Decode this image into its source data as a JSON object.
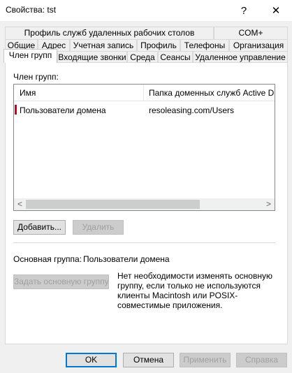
{
  "window": {
    "title": "Свойства: tst",
    "help_label": "?",
    "close_label": "✕"
  },
  "tabs": {
    "row1": [
      {
        "label": "Профиль служб удаленных рабочих столов"
      },
      {
        "label": "COM+"
      }
    ],
    "row2": [
      {
        "label": "Общие"
      },
      {
        "label": "Адрес"
      },
      {
        "label": "Учетная запись"
      },
      {
        "label": "Профиль"
      },
      {
        "label": "Телефоны"
      },
      {
        "label": "Организация"
      }
    ],
    "row3": [
      {
        "label": "Член групп"
      },
      {
        "label": "Входящие звонки"
      },
      {
        "label": "Среда"
      },
      {
        "label": "Сеансы"
      },
      {
        "label": "Удаленное управление"
      }
    ],
    "active": "Член групп"
  },
  "member_of": {
    "section_label": "Член групп:",
    "columns": [
      "Имя",
      "Папка доменных служб Active Directory"
    ],
    "rows": [
      {
        "name": "Пользователи домена",
        "folder": "resoleasing.com/Users"
      }
    ],
    "scroll_left": "<",
    "scroll_right": ">"
  },
  "buttons": {
    "add": "Добавить...",
    "remove": "Удалить",
    "set_primary": "Задать основную группу",
    "ok": "OK",
    "cancel": "Отмена",
    "apply": "Применить",
    "help": "Справка"
  },
  "primary_group": {
    "label": "Основная группа:",
    "value": "Пользователи домена",
    "info": "Нет необходимости изменять основную группу, если только не используются клиенты Macintosh или POSIX-совместимые приложения."
  },
  "colors": {
    "accent": "#0078d7",
    "marker": "#d0021b"
  }
}
